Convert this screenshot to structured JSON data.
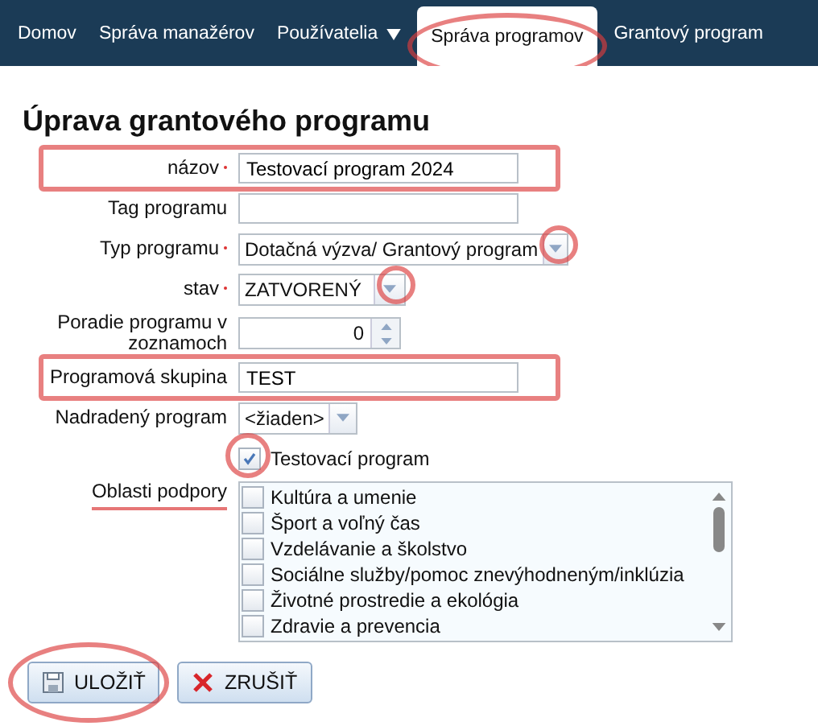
{
  "nav": {
    "items": [
      {
        "label": "Domov",
        "selected": false,
        "dropdown": false,
        "annotated": false
      },
      {
        "label": "Správa manažérov",
        "selected": false,
        "dropdown": false,
        "annotated": false
      },
      {
        "label": "Používatelia",
        "selected": false,
        "dropdown": true,
        "annotated": false
      },
      {
        "label": "Správa programov",
        "selected": true,
        "dropdown": false,
        "annotated": true
      },
      {
        "label": "Grantový program",
        "selected": false,
        "dropdown": false,
        "annotated": false
      }
    ]
  },
  "title": "Úprava grantového programu",
  "fields": [
    {
      "kind": "text",
      "label": "názov",
      "required": true,
      "value": "Testovací program 2024",
      "annotated": true
    },
    {
      "kind": "text",
      "label": "Tag programu",
      "required": false,
      "annotated": false
    },
    {
      "kind": "select",
      "label": "Typ programu",
      "required": true,
      "value": "Dotačná výzva/ Grantový program",
      "annotated": true
    },
    {
      "kind": "select",
      "label": "stav",
      "required": true,
      "value": "ZATVORENÝ",
      "annotated": true
    },
    {
      "kind": "number",
      "label": "Poradie programu v zoznamoch",
      "required": false,
      "value": "0",
      "annotated": false
    },
    {
      "kind": "text",
      "label": "Programová skupina",
      "required": false,
      "value": "TEST",
      "annotated": true
    },
    {
      "kind": "select",
      "label": "Nadradený program",
      "required": false,
      "value": "<žiaden>",
      "annotated": false
    }
  ],
  "test_checkbox": {
    "label": "Testovací program",
    "checked": true,
    "annotated": true
  },
  "areas": {
    "label": "Oblasti podpory",
    "annotated": true,
    "items": [
      {
        "label": "Kultúra a umenie",
        "checked": false
      },
      {
        "label": "Šport a voľný čas",
        "checked": false
      },
      {
        "label": "Vzdelávanie a školstvo",
        "checked": false
      },
      {
        "label": "Sociálne služby/pomoc znevýhodneným/inklúzia",
        "checked": false
      },
      {
        "label": "Životné prostredie a ekológia",
        "checked": false
      },
      {
        "label": "Zdravie a prevencia",
        "checked": false
      }
    ]
  },
  "buttons": [
    {
      "kind": "save",
      "label": "ULOŽIŤ",
      "annotated": true
    },
    {
      "kind": "cancel",
      "label": "ZRUŠIŤ",
      "annotated": false
    }
  ]
}
